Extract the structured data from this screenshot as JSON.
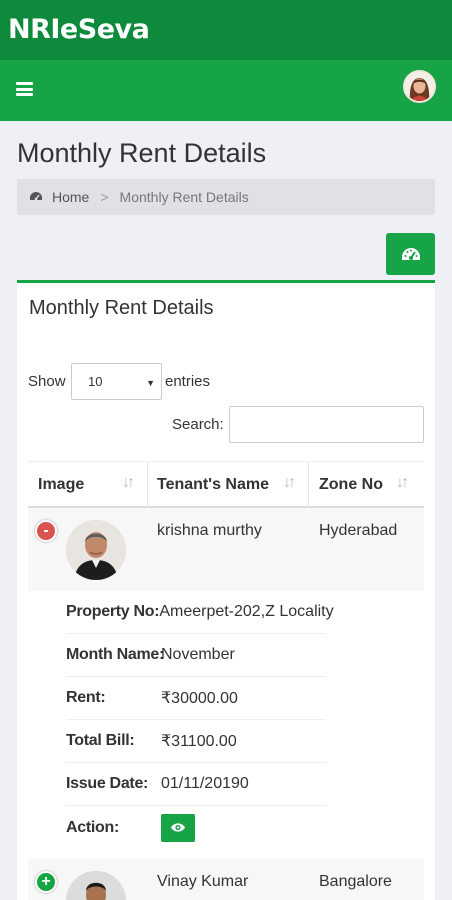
{
  "app": {
    "title": "NRIeSeva"
  },
  "page": {
    "title": "Monthly Rent Details"
  },
  "breadcrumb": {
    "home": "Home",
    "separator": ">",
    "current": "Monthly Rent Details"
  },
  "card": {
    "title": "Monthly Rent Details"
  },
  "length_menu": {
    "show": "Show",
    "value": "10",
    "entries": "entries"
  },
  "search": {
    "label": "Search:",
    "value": ""
  },
  "table": {
    "headers": [
      "Image",
      "Tenant's Name",
      "Zone No"
    ],
    "rows": [
      {
        "expanded": true,
        "toggle": "-",
        "name": "krishna murthy",
        "zone": "Hyderabad",
        "details": {
          "property_label": "Property No:",
          "property_value": "Ameerpet-202,Z Locality",
          "month_label": "Month Name:",
          "month_value": "November",
          "rent_label": "Rent:",
          "rent_value": "₹30000.00",
          "bill_label": "Total Bill:",
          "bill_value": "₹31100.00",
          "date_label": "Issue Date:",
          "date_value": "01/11/20190",
          "action_label": "Action:"
        }
      },
      {
        "expanded": false,
        "toggle": "+",
        "name": "Vinay Kumar",
        "zone": "Bangalore"
      }
    ]
  },
  "colors": {
    "app_bar": "#0e8a3c",
    "nav_bar": "#17a447",
    "accent": "#17a447",
    "collapse_toggle": "#d9534f"
  },
  "icons": {
    "menu": "hamburger-icon",
    "dashboard": "dashboard-icon",
    "view": "eye-icon",
    "sort": "sort-icon"
  }
}
